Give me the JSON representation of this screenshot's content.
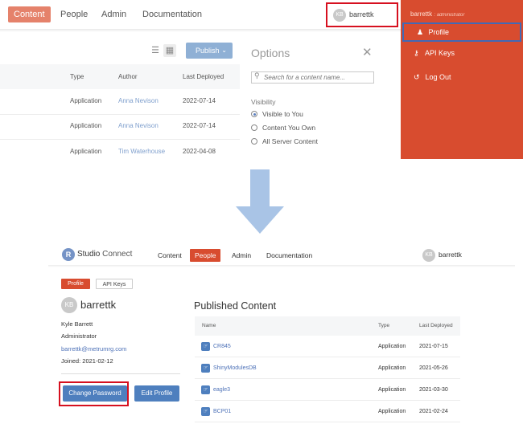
{
  "top": {
    "nav": {
      "tabs": [
        "Content",
        "People",
        "Admin",
        "Documentation"
      ],
      "active_tab": "Content",
      "user": {
        "initials": "KB",
        "name": "barrettk"
      }
    },
    "user_menu": {
      "username": "barrettk",
      "role": "administrator",
      "items": [
        {
          "label": "Profile",
          "icon": "user-icon"
        },
        {
          "label": "API Keys",
          "icon": "key-icon"
        },
        {
          "label": "Log Out",
          "icon": "logout-icon"
        }
      ]
    },
    "toolbar": {
      "publish_label": "Publish"
    },
    "content_table": {
      "columns": [
        "Type",
        "Author",
        "Last Deployed"
      ],
      "rows": [
        {
          "type": "Application",
          "author": "Anna Nevison",
          "deployed": "2022-07-14"
        },
        {
          "type": "Application",
          "author": "Anna Nevison",
          "deployed": "2022-07-14"
        },
        {
          "type": "Application",
          "author": "Tim Waterhouse",
          "deployed": "2022-04-08"
        }
      ]
    },
    "options": {
      "title": "Options",
      "search_placeholder": "Search for a content name...",
      "visibility_label": "Visibility",
      "visibility_options": [
        "Visible to You",
        "Content You Own",
        "All Server Content"
      ],
      "selected": "Visible to You"
    }
  },
  "bottom": {
    "brand": {
      "letter": "R",
      "name_bold": "Studio",
      "name_rest": " Connect"
    },
    "nav": {
      "tabs": [
        "Content",
        "People",
        "Admin",
        "Documentation"
      ],
      "active_tab": "People",
      "user": {
        "initials": "KB",
        "name": "barrettk"
      }
    },
    "subtabs": [
      "Profile",
      "API Keys"
    ],
    "profile": {
      "initials": "KB",
      "username": "barrettk",
      "full_name": "Kyle Barrett",
      "role": "Administrator",
      "email": "barrettk@metrumrg.com",
      "joined": "Joined: 2021-02-12",
      "change_password_label": "Change Password",
      "edit_profile_label": "Edit Profile"
    },
    "published": {
      "title": "Published Content",
      "columns": [
        "Name",
        "Type",
        "Last Deployed"
      ],
      "rows": [
        {
          "name": "CR845",
          "type": "Application",
          "deployed": "2021-07-15"
        },
        {
          "name": "ShinyModulesDB",
          "type": "Application",
          "deployed": "2021-05-26"
        },
        {
          "name": "eagle3",
          "type": "Application",
          "deployed": "2021-03-30"
        },
        {
          "name": "BCP01",
          "type": "Application",
          "deployed": "2021-02-24"
        }
      ]
    }
  },
  "colors": {
    "accent_red": "#d84c2f",
    "highlight_red": "#d6101f",
    "highlight_blue": "#4169b6",
    "button_blue": "#4e7fbe",
    "arrow_blue": "#a9c4e6"
  }
}
